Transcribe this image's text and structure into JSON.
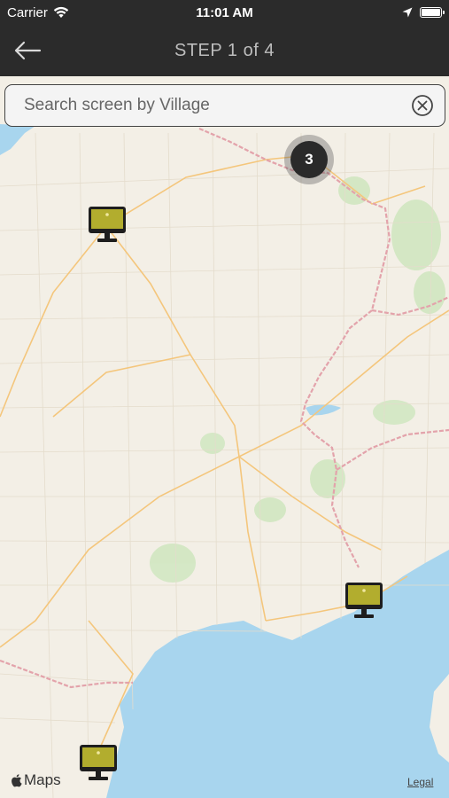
{
  "status_bar": {
    "carrier": "Carrier",
    "time": "11:01 AM",
    "icons": [
      "wifi-icon",
      "location-arrow-icon",
      "battery-icon"
    ]
  },
  "nav": {
    "title": "STEP 1 of 4",
    "back_icon": "back-arrow-icon"
  },
  "search": {
    "placeholder": "Search screen by Village",
    "value": "",
    "clear_icon": "clear-circle-icon"
  },
  "map": {
    "cluster": {
      "count": "3"
    },
    "screen_markers": [
      {
        "icon": "screen-marker-icon"
      },
      {
        "icon": "screen-marker-icon"
      },
      {
        "icon": "screen-marker-icon"
      }
    ],
    "attribution": "Maps",
    "legal": "Legal"
  },
  "colors": {
    "bar_bg": "#2b2b2b",
    "nav_title": "#bdbdbd",
    "land": "#f3efe6",
    "sea": "#a8d5ee",
    "marker_screen": "#b2ad2e",
    "cluster": "#2a2a2a"
  }
}
